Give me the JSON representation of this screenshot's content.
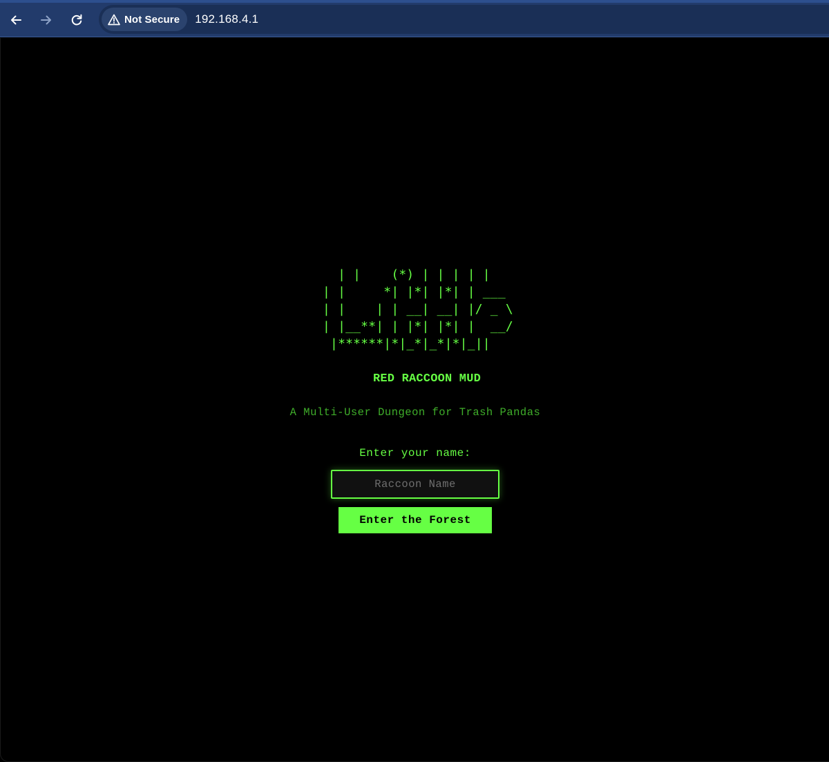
{
  "browser": {
    "security_label": "Not Secure",
    "url": "192.168.4.1",
    "icons": {
      "back": "arrow-left-icon",
      "forward": "arrow-right-icon",
      "reload": "reload-icon",
      "warning": "warning-triangle-icon"
    },
    "colors": {
      "toolbar": "#223b6b",
      "omnibox": "#1a2f56",
      "chip": "#2b436e"
    }
  },
  "page": {
    "ascii_logo": "  | |    (*) | | | | |\n| |     *| |*| |*| | ___\n| |    | | __| __| |/ _ \\\n| |__**| | |*| |*| |  __/\n |******|*|_*|_*|*|_||",
    "title": "RED RACCOON MUD",
    "subtitle": "A Multi-User Dungeon for Trash Pandas",
    "name_prompt": "Enter your name:",
    "name_input": {
      "value": "",
      "placeholder": "Raccoon Name"
    },
    "submit_label": "Enter the Forest",
    "colors": {
      "background": "#000000",
      "accent": "#66ff44",
      "subtitle": "#3fae2a"
    }
  }
}
